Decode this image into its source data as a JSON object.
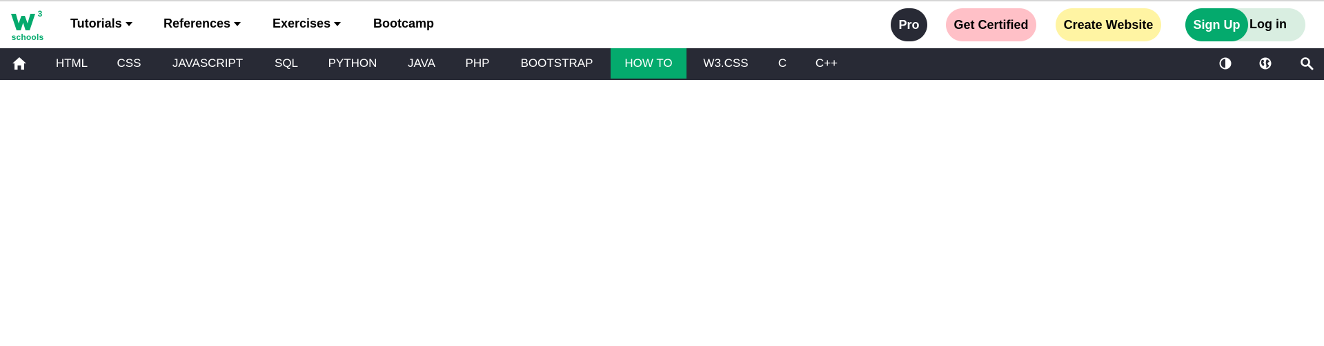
{
  "logo": {
    "number": "3",
    "text": "schools",
    "brand_color": "#04aa6d"
  },
  "top_menu": [
    {
      "label": "Tutorials",
      "has_dropdown": true
    },
    {
      "label": "References",
      "has_dropdown": true
    },
    {
      "label": "Exercises",
      "has_dropdown": true
    },
    {
      "label": "Bootcamp",
      "has_dropdown": false
    }
  ],
  "top_buttons": {
    "pro": "Pro",
    "certified": "Get Certified",
    "website": "Create Website",
    "signup": "Sign Up",
    "login": "Log in"
  },
  "nav": {
    "home_icon": "home-icon",
    "items": [
      {
        "label": "HTML",
        "active": false
      },
      {
        "label": "CSS",
        "active": false
      },
      {
        "label": "JAVASCRIPT",
        "active": false
      },
      {
        "label": "SQL",
        "active": false
      },
      {
        "label": "PYTHON",
        "active": false
      },
      {
        "label": "JAVA",
        "active": false
      },
      {
        "label": "PHP",
        "active": false
      },
      {
        "label": "BOOTSTRAP",
        "active": false
      },
      {
        "label": "HOW TO",
        "active": true
      },
      {
        "label": "W3.CSS",
        "active": false
      },
      {
        "label": "C",
        "active": false
      },
      {
        "label": "C++",
        "active": false
      }
    ],
    "right_icons": [
      "contrast-icon",
      "globe-icon",
      "search-icon"
    ]
  },
  "colors": {
    "nav_bg": "#282a35",
    "accent": "#04aa6d",
    "pro_bg": "#282a35",
    "certified_bg": "#ffc0c7",
    "website_bg": "#fff4a3",
    "login_bg": "#d9eee1"
  }
}
